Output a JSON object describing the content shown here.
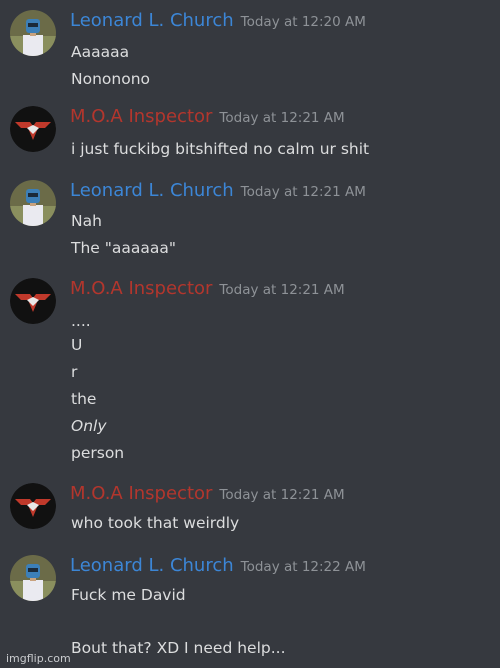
{
  "colors": {
    "background": "#36393f",
    "leonard_name": "#3c86d6",
    "moa_name": "#b3362d",
    "message_text": "#dcddde",
    "timestamp": "#8e9297"
  },
  "messages": [
    {
      "author": "Leonard L. Church",
      "author_color": "#3c86d6",
      "avatar": "leonard-avatar",
      "timestamp": "Today at 12:20 AM",
      "lines": [
        "Aaaaaa",
        "Nononono"
      ]
    },
    {
      "author": "M.O.A Inspector",
      "author_color": "#b3362d",
      "avatar": "moa-eagle-avatar",
      "timestamp": "Today at 12:21 AM",
      "lines": [
        "i just fuckibg bitshifted no calm ur shit"
      ]
    },
    {
      "author": "Leonard L. Church",
      "author_color": "#3c86d6",
      "avatar": "leonard-avatar",
      "timestamp": "Today at 12:21 AM",
      "lines": [
        "Nah",
        "The \"aaaaaa\""
      ]
    },
    {
      "author": "M.O.A Inspector",
      "author_color": "#b3362d",
      "avatar": "moa-eagle-avatar",
      "timestamp": "Today at 12:21 AM",
      "lines": [
        "....",
        "U",
        "r",
        "the",
        "Only",
        "person"
      ]
    },
    {
      "author": "M.O.A Inspector",
      "author_color": "#b3362d",
      "avatar": "moa-eagle-avatar",
      "timestamp": "Today at 12:21 AM",
      "lines": [
        "who took that weirdly"
      ]
    },
    {
      "author": "Leonard L. Church",
      "author_color": "#3c86d6",
      "avatar": "leonard-avatar",
      "timestamp": "Today at 12:22 AM",
      "lines": [
        "Fuck me David",
        "",
        "Bout that? XD I need help..."
      ]
    }
  ],
  "watermark": "imgflip.com"
}
